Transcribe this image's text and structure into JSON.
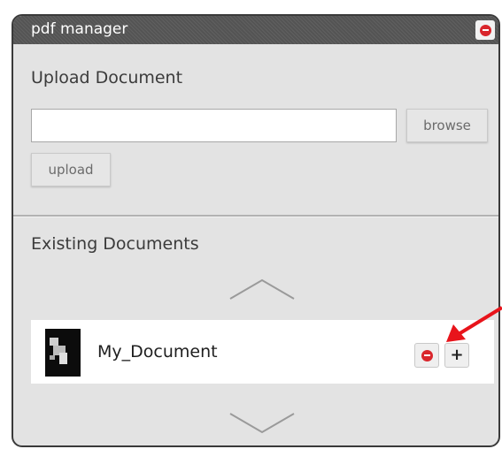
{
  "window": {
    "title": "pdf manager",
    "close_icon": "minus-circle-icon"
  },
  "upload": {
    "heading": "Upload Document",
    "file_input": {
      "value": "",
      "placeholder": ""
    },
    "browse_label": "browse",
    "upload_label": "upload"
  },
  "existing": {
    "heading": "Existing Documents",
    "scroll_up_icon": "chevron-up-icon",
    "scroll_down_icon": "chevron-down-icon",
    "documents": [
      {
        "name": "My_Document",
        "thumbnail_icon": "pdf-thumbnail-icon",
        "remove_icon": "minus-circle-icon",
        "add_icon": "plus-icon"
      }
    ]
  },
  "colors": {
    "titlebar": "#545454",
    "panel_bg": "#e3e3e3",
    "remove_red": "#d9262c",
    "annotation_arrow": "#e8141b"
  }
}
